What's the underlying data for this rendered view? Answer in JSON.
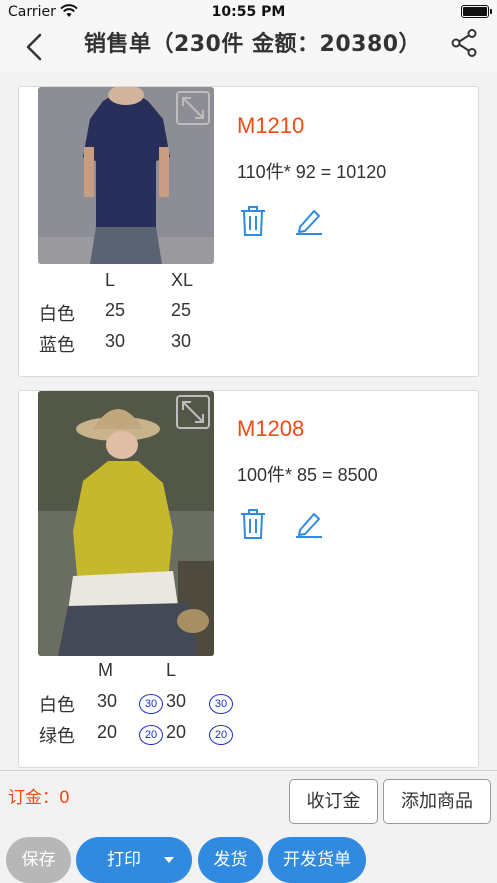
{
  "status": {
    "carrier": "Carrier",
    "time": "10:55 PM"
  },
  "nav": {
    "title": "销售单（230件 金额：20380）",
    "back_icon": "chevron-left-icon",
    "share_icon": "share-icon"
  },
  "colors": {
    "accent": "#2f8ae0",
    "price_red": "#f24a14",
    "badge_blue": "#1a2ecc",
    "disabled_grey": "#b7b7b7"
  },
  "items": [
    {
      "code": "M1210",
      "formula": "110件* 92 = 10120",
      "sizes": [
        "L",
        "XL"
      ],
      "rows": [
        {
          "color": "白色",
          "qty": [
            "25",
            "25"
          ]
        },
        {
          "color": "蓝色",
          "qty": [
            "30",
            "30"
          ]
        }
      ]
    },
    {
      "code": "M1208",
      "formula": "100件* 85 = 8500",
      "sizes": [
        "M",
        "L"
      ],
      "rows": [
        {
          "color": "白色",
          "qty": [
            "30",
            "30"
          ],
          "badges": [
            "30",
            "30"
          ]
        },
        {
          "color": "绿色",
          "qty": [
            "20",
            "20"
          ],
          "badges": [
            "20",
            "20"
          ]
        }
      ]
    }
  ],
  "footer": {
    "deposit": "订金：0",
    "collect_deposit": "收订金",
    "add_product": "添加商品",
    "save": "保存",
    "print": "打印",
    "ship": "发货",
    "invoice": "开发货单"
  }
}
